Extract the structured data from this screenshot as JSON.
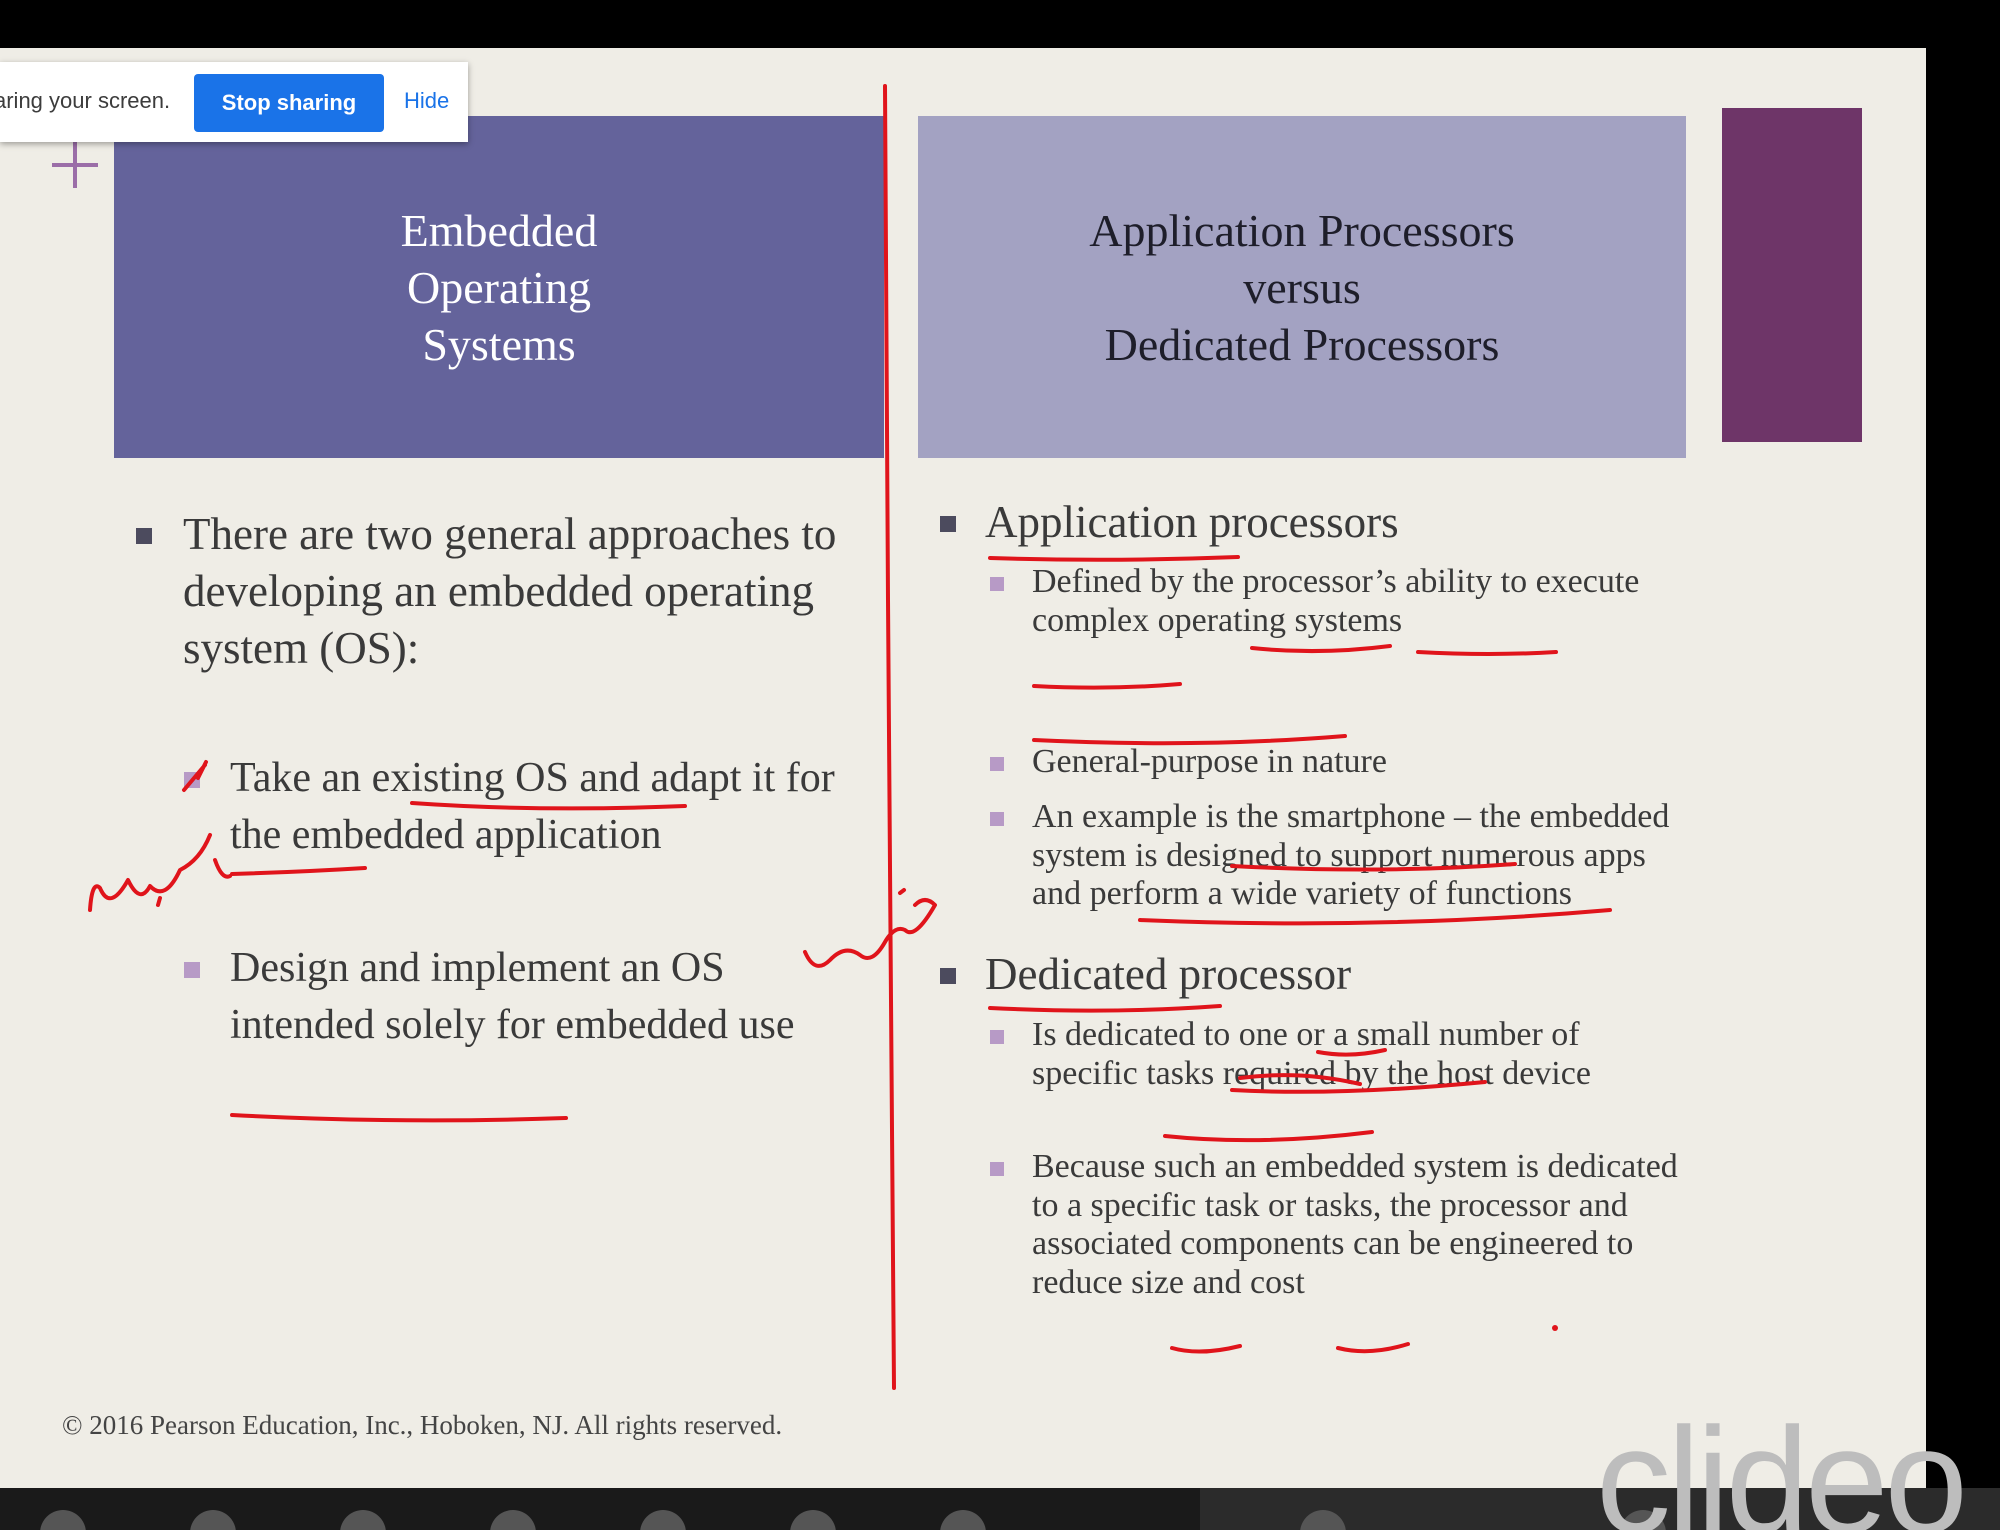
{
  "share_banner": {
    "text": "aring your screen.",
    "stop_label": "Stop sharing",
    "hide_label": "Hide"
  },
  "left_header": {
    "title": "Embedded\nOperating\nSystems"
  },
  "right_header": {
    "title": "Application Processors\nversus\nDedicated Processors"
  },
  "left_content": {
    "bullet1": "There are two general approaches to developing an embedded operating system (OS):",
    "sub1": "Take an existing OS and adapt it for the embedded application",
    "sub2": "Design and implement an OS intended solely for embedded use"
  },
  "right_content": {
    "app_heading": "Application processors",
    "app_sub1": "Defined by the processor’s ability to execute complex operating systems",
    "app_sub2": "General-purpose in nature",
    "app_sub3": "An example is the smartphone – the embedded system is designed to support numerous apps and perform a wide variety of functions",
    "ded_heading": "Dedicated processor",
    "ded_sub1": "Is dedicated to one or a small number of specific tasks required by the host device",
    "ded_sub2": "Because such an embedded system is dedicated to a specific task or tasks, the processor and associated components can be engineered to reduce size and cost"
  },
  "footer": {
    "copyright": "© 2016 Pearson Education, Inc., Hoboken, NJ. All rights reserved."
  },
  "watermark": {
    "text": "clideo"
  },
  "colors": {
    "left_header_bg": "#64639b",
    "right_header_bg": "#a3a2c2",
    "accent": "#6e3568",
    "annotation_red": "#e0141b",
    "stop_button": "#1a73e8"
  },
  "icons": [
    "plus-icon"
  ]
}
